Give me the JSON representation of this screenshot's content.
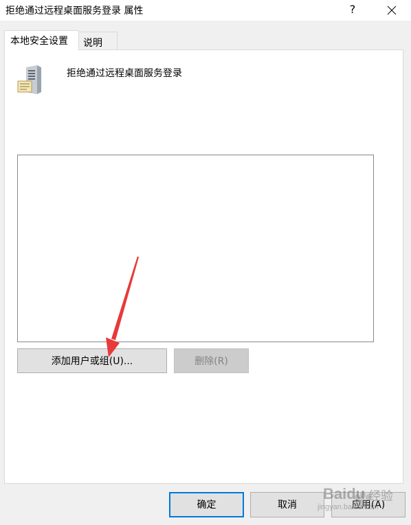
{
  "window": {
    "title": "拒绝通过远程桌面服务登录 属性",
    "help_label": "?"
  },
  "tabs": [
    {
      "label": "本地安全设置",
      "active": true
    },
    {
      "label": "说明",
      "active": false
    }
  ],
  "policy": {
    "name": "拒绝通过远程桌面服务登录",
    "icon": "server-icon"
  },
  "list": {
    "items": []
  },
  "buttons": {
    "add_user_group": "添加用户或组(U)...",
    "remove": "删除(R)",
    "ok": "确定",
    "cancel": "取消",
    "apply": "应用(A)"
  },
  "watermark": {
    "brand": "Baidu",
    "jingyan": "经验",
    "url": "jingyan.baidu.com"
  },
  "colors": {
    "focus_border": "#0078d7",
    "arrow": "#e83a3a"
  }
}
